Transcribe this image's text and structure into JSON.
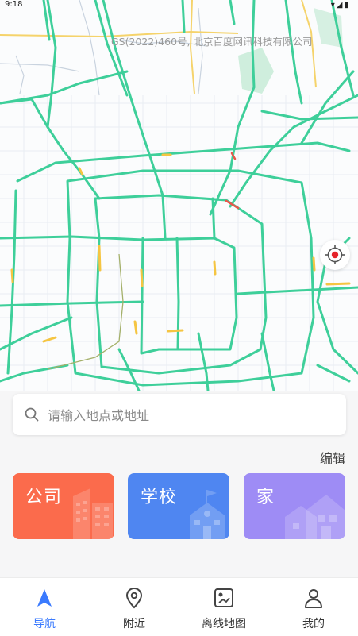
{
  "status_bar": {
    "time": "9:18"
  },
  "map": {
    "copyright": "GS(2022)460号, 北京百度网讯科技有限公司",
    "road_color": "#3ecf9a",
    "congestion_color": "#f5c542",
    "jam_color": "#e8574a"
  },
  "search": {
    "placeholder": "请输入地点或地址"
  },
  "shortcuts": {
    "edit_label": "编辑",
    "items": [
      {
        "label": "公司",
        "color": "#fb6b4c",
        "icon": "office-building-icon"
      },
      {
        "label": "学校",
        "color": "#4f86f1",
        "icon": "school-icon"
      },
      {
        "label": "家",
        "color": "#9e8cf5",
        "icon": "house-icon"
      }
    ]
  },
  "bottom_nav": {
    "items": [
      {
        "label": "导航",
        "icon": "navigation-arrow-icon",
        "active": true
      },
      {
        "label": "附近",
        "icon": "location-pin-icon",
        "active": false
      },
      {
        "label": "离线地图",
        "icon": "offline-map-icon",
        "active": false
      },
      {
        "label": "我的",
        "icon": "user-profile-icon",
        "active": false
      }
    ]
  },
  "colors": {
    "accent": "#3a7afe"
  }
}
